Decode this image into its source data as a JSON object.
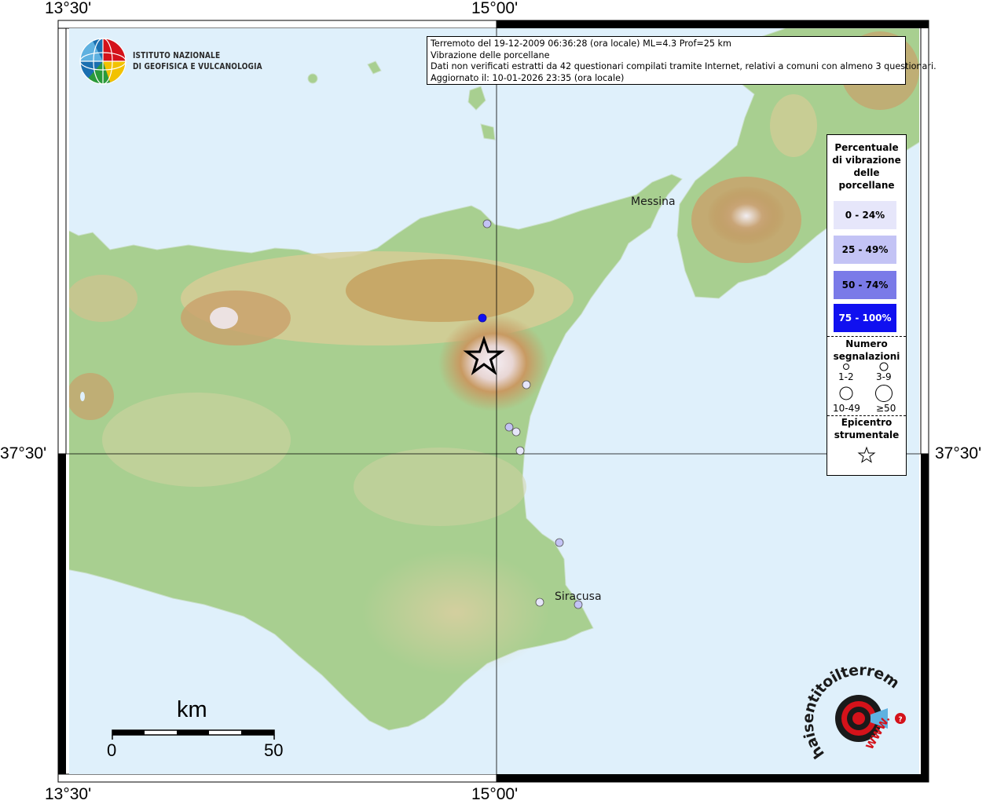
{
  "header": {
    "line1": "Terremoto del 19-12-2009 06:36:28 (ora locale) ML=4.3 Prof=25 km",
    "line2": "Vibrazione delle porcellane",
    "line3": "Dati non verificati estratti da 42 questionari compilati tramite Internet, relativi a comuni con almeno 3 questionari.",
    "line4": "Aggiornato il: 10-01-2026 23:35 (ora locale)"
  },
  "institute": {
    "line1": "ISTITUTO NAZIONALE",
    "line2": "DI GEOFISICA E VULCANOLOGIA"
  },
  "axes": {
    "lon_left": "13°30'",
    "lon_center": "15°00'",
    "lat_mid": "37°30'"
  },
  "places": {
    "messina": "Messina",
    "siracusa": "Siracusa"
  },
  "scale": {
    "unit": "km",
    "min": "0",
    "max": "50"
  },
  "legend": {
    "title_line1": "Percentuale",
    "title_line2": "di vibrazione",
    "title_line3": "delle",
    "title_line4": "porcellane",
    "classes": [
      {
        "label": "0 - 24%",
        "color": "#e6e6fa"
      },
      {
        "label": "25 - 49%",
        "color": "#c3c3f5"
      },
      {
        "label": "50 - 74%",
        "color": "#7a7ae8"
      },
      {
        "label": "75 - 100%",
        "color": "#1010f0"
      }
    ],
    "count_title_line1": "Numero",
    "count_title_line2": "segnalazioni",
    "count_1": "1-2",
    "count_2": "3-9",
    "count_3": "10-49",
    "count_4": "≥50",
    "epi_line1": "Epicentro",
    "epi_line2": "strumentale"
  },
  "logo": {
    "arc_text": "haisentitoilterremoto.it",
    "www": "WWW."
  },
  "colors": {
    "sea": "#dff0fb",
    "land_low": "#9fc98a",
    "land_mid": "#d9cf9a",
    "land_high": "#b98b4e",
    "peak": "#f4eef4",
    "accent_red": "#d4121a"
  }
}
